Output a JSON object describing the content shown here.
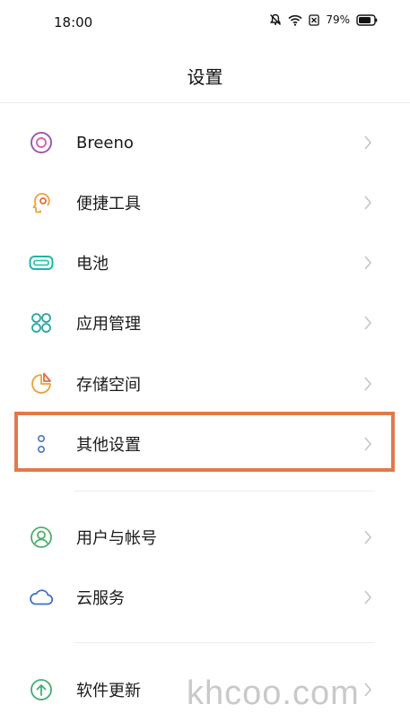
{
  "status_bar": {
    "time": "18:00",
    "battery_percent": "79%",
    "icons": [
      "mute-bell-icon",
      "wifi-icon",
      "no-sim-icon",
      "battery-icon"
    ]
  },
  "header": {
    "title": "设置"
  },
  "settings": {
    "group1": [
      {
        "label": "Breeno",
        "icon": "breeno-icon",
        "color": "#9b5ab8"
      },
      {
        "label": "便捷工具",
        "icon": "tools-icon",
        "color": "#e8a23a"
      },
      {
        "label": "电池",
        "icon": "battery-icon",
        "color": "#1fb5a3"
      },
      {
        "label": "应用管理",
        "icon": "apps-grid-icon",
        "color": "#2aa7a0"
      },
      {
        "label": "存储空间",
        "icon": "storage-pie-icon",
        "color": "#e8a23a"
      },
      {
        "label": "其他设置",
        "icon": "more-dots-icon",
        "color": "#4a73c7"
      }
    ],
    "group2": [
      {
        "label": "用户与帐号",
        "icon": "user-icon",
        "color": "#4caf6a"
      },
      {
        "label": "云服务",
        "icon": "cloud-icon",
        "color": "#3f6fc4"
      }
    ],
    "group3": [
      {
        "label": "软件更新",
        "icon": "update-arrow-icon",
        "color": "#3fae72"
      }
    ]
  },
  "highlight": {
    "color": "#e07a4a",
    "target": "其他设置"
  },
  "watermark": "khcoo.com"
}
